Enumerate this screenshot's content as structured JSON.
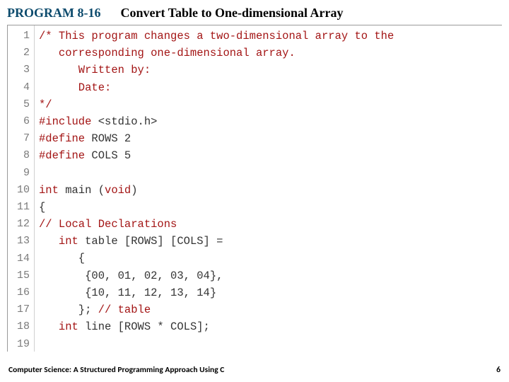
{
  "header": {
    "program_label": "PROGRAM 8-16",
    "program_title": "Convert Table to One-dimensional Array"
  },
  "code": {
    "lines": [
      {
        "n": "1",
        "segments": [
          {
            "cls": "comment",
            "text": "/* This program changes a two-dimensional array to the"
          }
        ]
      },
      {
        "n": "2",
        "segments": [
          {
            "cls": "comment",
            "text": "   corresponding one-dimensional array."
          }
        ]
      },
      {
        "n": "3",
        "segments": [
          {
            "cls": "comment",
            "text": "      Written by:"
          }
        ]
      },
      {
        "n": "4",
        "segments": [
          {
            "cls": "comment",
            "text": "      Date:"
          }
        ]
      },
      {
        "n": "5",
        "segments": [
          {
            "cls": "comment",
            "text": "*/"
          }
        ]
      },
      {
        "n": "6",
        "segments": [
          {
            "cls": "keyword-pp",
            "text": "#include"
          },
          {
            "cls": "plain",
            "text": " <stdio.h>"
          }
        ]
      },
      {
        "n": "7",
        "segments": [
          {
            "cls": "keyword-pp",
            "text": "#define"
          },
          {
            "cls": "plain",
            "text": " ROWS 2"
          }
        ]
      },
      {
        "n": "8",
        "segments": [
          {
            "cls": "keyword-pp",
            "text": "#define"
          },
          {
            "cls": "plain",
            "text": " COLS 5"
          }
        ]
      },
      {
        "n": "9",
        "segments": []
      },
      {
        "n": "10",
        "segments": [
          {
            "cls": "keyword",
            "text": "int"
          },
          {
            "cls": "plain",
            "text": " main ("
          },
          {
            "cls": "keyword",
            "text": "void"
          },
          {
            "cls": "plain",
            "text": ")"
          }
        ]
      },
      {
        "n": "11",
        "segments": [
          {
            "cls": "plain",
            "text": "{"
          }
        ]
      },
      {
        "n": "12",
        "segments": [
          {
            "cls": "comment",
            "text": "// Local Declarations"
          }
        ]
      },
      {
        "n": "13",
        "segments": [
          {
            "cls": "plain",
            "text": "   "
          },
          {
            "cls": "keyword",
            "text": "int"
          },
          {
            "cls": "plain",
            "text": " table [ROWS] [COLS] ="
          }
        ]
      },
      {
        "n": "14",
        "segments": [
          {
            "cls": "plain",
            "text": "      {"
          }
        ]
      },
      {
        "n": "15",
        "segments": [
          {
            "cls": "plain",
            "text": "       {00, 01, 02, 03, 04},"
          }
        ]
      },
      {
        "n": "16",
        "segments": [
          {
            "cls": "plain",
            "text": "       {10, 11, 12, 13, 14}"
          }
        ]
      },
      {
        "n": "17",
        "segments": [
          {
            "cls": "plain",
            "text": "      }; "
          },
          {
            "cls": "comment",
            "text": "// table"
          }
        ]
      },
      {
        "n": "18",
        "segments": [
          {
            "cls": "plain",
            "text": "   "
          },
          {
            "cls": "keyword",
            "text": "int"
          },
          {
            "cls": "plain",
            "text": " line [ROWS * COLS];"
          }
        ]
      },
      {
        "n": "19",
        "segments": []
      }
    ]
  },
  "footer": {
    "book_title": "Computer Science: A Structured Programming Approach Using C",
    "page_number": "6"
  }
}
